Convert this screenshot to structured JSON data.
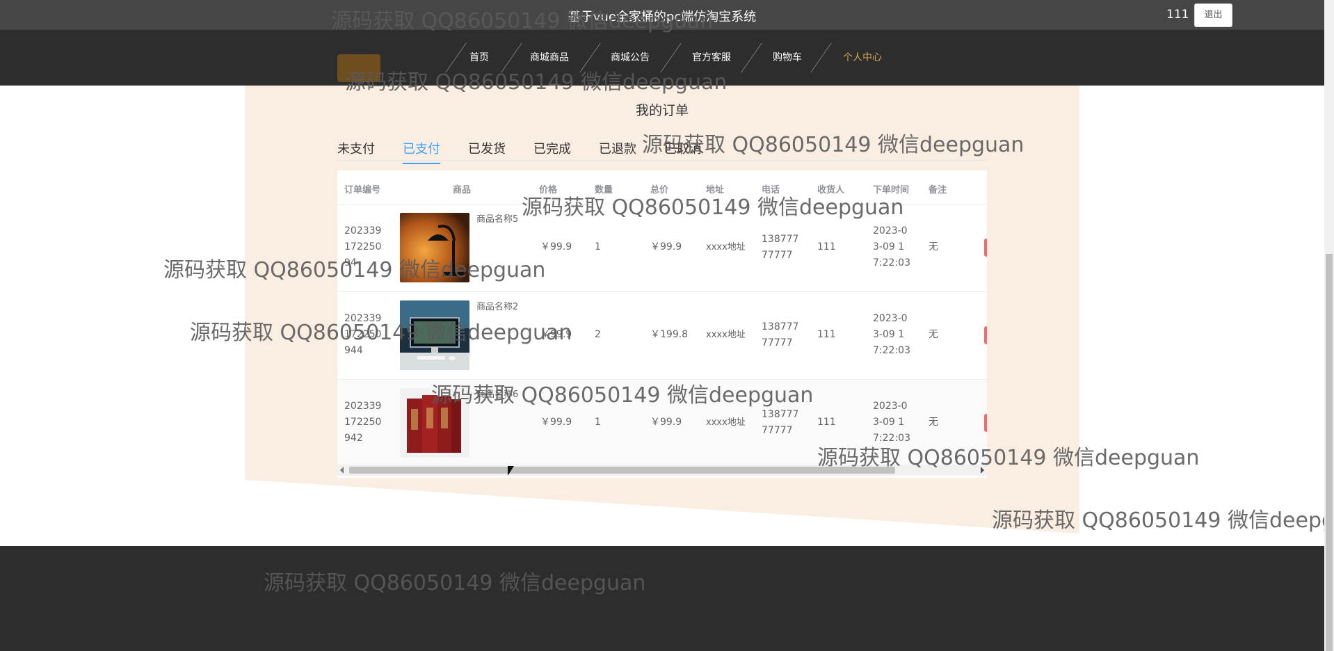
{
  "header": {
    "title": "基于vue全家桶的pc端仿淘宝系统",
    "username": "111",
    "logout_label": "退出"
  },
  "nav": {
    "items": [
      {
        "label": "首页"
      },
      {
        "label": "商城商品"
      },
      {
        "label": "商城公告"
      },
      {
        "label": "官方客服"
      },
      {
        "label": "购物车"
      },
      {
        "label": "个人中心",
        "active": true
      }
    ]
  },
  "page": {
    "heading": "我的订单"
  },
  "tabs": [
    {
      "label": "未支付"
    },
    {
      "label": "已支付",
      "active": true
    },
    {
      "label": "已发货"
    },
    {
      "label": "已完成"
    },
    {
      "label": "已退款"
    },
    {
      "label": "已取消"
    }
  ],
  "table": {
    "columns": [
      "订单编号",
      "商品",
      "价格",
      "数量",
      "总价",
      "地址",
      "电话",
      "收货人",
      "下单时间",
      "备注"
    ],
    "rows": [
      {
        "order_no": "20233917225094",
        "product_image": "desk-lamp",
        "product_name": "商品名称5",
        "price": "￥99.9",
        "quantity": "1",
        "total": "￥99.9",
        "address": "xxxx地址",
        "phone": "13877777777",
        "receiver": "111",
        "order_time": "2023-03-09 17:22:03",
        "remark": "无"
      },
      {
        "order_no": "202339172250944",
        "product_image": "desktop-computer",
        "product_name": "商品名称2",
        "price": "￥99.9",
        "quantity": "2",
        "total": "￥199.8",
        "address": "xxxx地址",
        "phone": "13877777777",
        "receiver": "111",
        "order_time": "2023-03-09 17:22:03",
        "remark": "无"
      },
      {
        "order_no": "202339172250942",
        "product_image": "red-books",
        "product_name": "商品名称6",
        "price": "￥99.9",
        "quantity": "1",
        "total": "￥99.9",
        "address": "xxxx地址",
        "phone": "13877777777",
        "receiver": "111",
        "order_time": "2023-03-09 17:22:03",
        "remark": "无"
      }
    ]
  },
  "watermark": "源码获取 QQ86050149 微信deepguan",
  "colors": {
    "topbar": "#464646",
    "navbar": "#2d2d2d",
    "nav_active": "#d4a857",
    "tab_active": "#409eff",
    "panel_bg": "#faeee3",
    "action_red": "#f56c6c"
  }
}
